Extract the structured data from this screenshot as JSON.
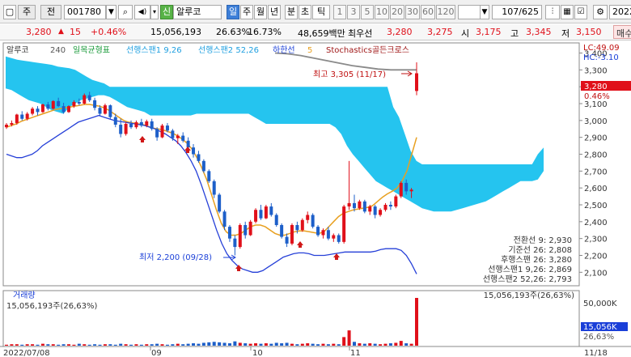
{
  "toolbar": {
    "period_label": "주",
    "prev_label": "전",
    "code": "001780",
    "sin_label": "신",
    "stock_name": "알루코",
    "period_tabs": [
      "일",
      "주",
      "월",
      "년",
      "분",
      "초",
      "틱"
    ],
    "active_period": "일",
    "interval_buttons": [
      "1",
      "3",
      "5",
      "10",
      "20",
      "30",
      "60",
      "120"
    ],
    "page_counter": "107/625",
    "date_field": "2022"
  },
  "quote": {
    "price": "3,280",
    "change": "15",
    "change_pct": "+0.46%",
    "volume": "15,056,193",
    "turnover_pct": "26.63%",
    "ratio": "16.73%",
    "amount": "48,659백만",
    "best_label": "최우선",
    "ask": "3,280",
    "bid": "3,275",
    "open_label": "시",
    "open": "3,175",
    "high_label": "고",
    "high": "3,345",
    "low_label": "저",
    "low": "3,150",
    "order_label": "매수"
  },
  "legend": {
    "stock": "알루코",
    "period": "240",
    "ichimoku": "일목균형표",
    "span1": "선행스팬1 9,26",
    "span2": "선행스팬2 52,26",
    "lower_line": "하한선",
    "num5": "5",
    "stoch": "Stochastics골든크로스"
  },
  "annotations": {
    "max": "최고 3,305 (11/17)",
    "min": "최저 2,200 (09/28)"
  },
  "right_info": {
    "lc": "LC:49.09",
    "hc": "HC:-3.10",
    "price_tag": "3,280",
    "pct_tag": "0.46%",
    "values": [
      {
        "text": "전환선 9: 2,930",
        "color": "#1e9fe0"
      },
      {
        "text": "기준선 26: 2,808",
        "color": "#333333"
      },
      {
        "text": "후행스팬 26: 3,280",
        "color": "#a020a0"
      },
      {
        "text": "선행스팬1 9,26: 2,869",
        "color": "#1e9fe0"
      },
      {
        "text": "선행스팬2 52,26: 2,793",
        "color": "#1a3fd8"
      }
    ]
  },
  "volume_panel": {
    "title": "거래량",
    "value_left": "15,056,193주(26,63%)",
    "value_right": "15,056,193주(26,63%)",
    "axis_label": "50,000K",
    "tag": "15,056K",
    "tag_pct": "26,63%"
  },
  "colors": {
    "up": "#e0101a",
    "down": "#1d5fc9",
    "cloud": "#19c1ee",
    "ma": "#e8a020",
    "lower": "#2640d8",
    "gray_line": "#8a8a8a"
  },
  "chart_data": {
    "type": "candlestick",
    "y_ticks": [
      2100,
      2200,
      2300,
      2400,
      2500,
      2600,
      2700,
      2800,
      2900,
      3000,
      3100,
      3200,
      3300,
      3400
    ],
    "ylim": [
      2020,
      3460
    ],
    "x_labels": [
      "2022/07/08",
      "09",
      "10",
      "11",
      "11/18"
    ],
    "candles": [
      [
        2960,
        2985,
        2950,
        2975
      ],
      [
        2975,
        3000,
        2965,
        2985
      ],
      [
        2985,
        3040,
        2975,
        3035
      ],
      [
        3035,
        3055,
        3000,
        3010
      ],
      [
        3010,
        3050,
        3000,
        3040
      ],
      [
        3040,
        3080,
        3030,
        3070
      ],
      [
        3070,
        3085,
        3030,
        3050
      ],
      [
        3050,
        3100,
        3045,
        3095
      ],
      [
        3095,
        3110,
        3060,
        3070
      ],
      [
        3070,
        3120,
        3065,
        3115
      ],
      [
        3115,
        3135,
        3080,
        3085
      ],
      [
        3085,
        3105,
        3040,
        3050
      ],
      [
        3050,
        3090,
        3045,
        3085
      ],
      [
        3085,
        3120,
        3075,
        3110
      ],
      [
        3110,
        3130,
        3090,
        3100
      ],
      [
        3100,
        3160,
        3095,
        3150
      ],
      [
        3150,
        3170,
        3110,
        3120
      ],
      [
        3120,
        3135,
        3060,
        3075
      ],
      [
        3075,
        3090,
        3030,
        3040
      ],
      [
        3040,
        3100,
        3035,
        3090
      ],
      [
        3090,
        3095,
        3010,
        3020
      ],
      [
        3020,
        3040,
        2960,
        2975
      ],
      [
        2975,
        3010,
        2900,
        2920
      ],
      [
        2920,
        2990,
        2910,
        2980
      ],
      [
        2980,
        3000,
        2950,
        2960
      ],
      [
        2960,
        3000,
        2950,
        2990
      ],
      [
        2990,
        3010,
        2960,
        2970
      ],
      [
        2970,
        3005,
        2960,
        2995
      ],
      [
        2995,
        3010,
        2940,
        2950
      ],
      [
        2950,
        2960,
        2880,
        2900
      ],
      [
        2900,
        2980,
        2895,
        2970
      ],
      [
        2970,
        2985,
        2930,
        2940
      ],
      [
        2940,
        2950,
        2880,
        2895
      ],
      [
        2895,
        2920,
        2860,
        2910
      ],
      [
        2910,
        2930,
        2870,
        2880
      ],
      [
        2880,
        2900,
        2830,
        2840
      ],
      [
        2840,
        2860,
        2780,
        2800
      ],
      [
        2800,
        2820,
        2750,
        2760
      ],
      [
        2760,
        2770,
        2690,
        2700
      ],
      [
        2700,
        2710,
        2630,
        2640
      ],
      [
        2640,
        2650,
        2540,
        2560
      ],
      [
        2560,
        2570,
        2450,
        2460
      ],
      [
        2460,
        2470,
        2350,
        2370
      ],
      [
        2370,
        2380,
        2280,
        2300
      ],
      [
        2300,
        2320,
        2200,
        2250
      ],
      [
        2250,
        2390,
        2240,
        2380
      ],
      [
        2380,
        2400,
        2300,
        2320
      ],
      [
        2320,
        2410,
        2315,
        2400
      ],
      [
        2400,
        2480,
        2390,
        2470
      ],
      [
        2470,
        2500,
        2410,
        2420
      ],
      [
        2420,
        2500,
        2415,
        2490
      ],
      [
        2490,
        2510,
        2430,
        2440
      ],
      [
        2440,
        2450,
        2370,
        2380
      ],
      [
        2380,
        2390,
        2300,
        2310
      ],
      [
        2310,
        2330,
        2250,
        2270
      ],
      [
        2270,
        2390,
        2260,
        2380
      ],
      [
        2380,
        2400,
        2330,
        2350
      ],
      [
        2350,
        2420,
        2340,
        2410
      ],
      [
        2410,
        2460,
        2390,
        2440
      ],
      [
        2440,
        2450,
        2360,
        2370
      ],
      [
        2370,
        2380,
        2310,
        2320
      ],
      [
        2320,
        2360,
        2300,
        2350
      ],
      [
        2350,
        2370,
        2290,
        2300
      ],
      [
        2300,
        2330,
        2280,
        2320
      ],
      [
        2320,
        2330,
        2270,
        2280
      ],
      [
        2280,
        2500,
        2270,
        2490
      ],
      [
        2490,
        2760,
        2470,
        2510
      ],
      [
        2510,
        2560,
        2460,
        2480
      ],
      [
        2480,
        2530,
        2470,
        2520
      ],
      [
        2520,
        2530,
        2450,
        2460
      ],
      [
        2460,
        2500,
        2440,
        2490
      ],
      [
        2490,
        2500,
        2420,
        2440
      ],
      [
        2440,
        2480,
        2430,
        2470
      ],
      [
        2470,
        2510,
        2460,
        2500
      ],
      [
        2500,
        2520,
        2470,
        2490
      ],
      [
        2490,
        2560,
        2480,
        2550
      ],
      [
        2550,
        2640,
        2540,
        2630
      ],
      [
        2630,
        2650,
        2560,
        2580
      ],
      [
        2580,
        2600,
        2540,
        2590
      ],
      [
        3175,
        3345,
        3150,
        3280
      ]
    ],
    "volumes": [
      2,
      3,
      3,
      2,
      3,
      3,
      2,
      4,
      3,
      3,
      2,
      3,
      3,
      2,
      4,
      3,
      2,
      3,
      2,
      3,
      3,
      2,
      4,
      3,
      2,
      3,
      2,
      3,
      3,
      4,
      3,
      2,
      3,
      4,
      3,
      4,
      5,
      4,
      6,
      7,
      8,
      7,
      6,
      5,
      9,
      6,
      5,
      4,
      5,
      4,
      5,
      4,
      6,
      5,
      6,
      4,
      3,
      4,
      5,
      4,
      3,
      4,
      3,
      4,
      3,
      18,
      32,
      8,
      5,
      4,
      5,
      4,
      3,
      4,
      5,
      6,
      10,
      5,
      4,
      100
    ],
    "cloud_upper": [
      3380,
      3370,
      3360,
      3355,
      3350,
      3345,
      3340,
      3335,
      3330,
      3320,
      3315,
      3310,
      3300,
      3280,
      3260,
      3240,
      3230,
      3220,
      3200,
      3200,
      3200,
      3200,
      3200,
      3200,
      3200,
      3200,
      3200,
      3200,
      3200,
      3200,
      3200,
      3200,
      3200,
      3200,
      3200,
      3200,
      3200,
      3200,
      3200,
      3200,
      3200,
      3200,
      3200,
      3200,
      3200,
      3200,
      3200,
      3200,
      3200,
      3200,
      3200,
      3200,
      3200,
      3200,
      3200,
      3200,
      3200,
      3200,
      3200,
      3200,
      3200,
      3200,
      3200,
      3200,
      3200,
      3200,
      3200,
      3080,
      3020,
      2920,
      2820,
      2760,
      2740,
      2740,
      2740,
      2740,
      2740,
      2740,
      2740,
      2740,
      2740,
      2740,
      2740,
      2740,
      2740,
      2740,
      2740,
      2740,
      2740,
      2740,
      2740,
      2740,
      2800,
      2840
    ],
    "cloud_lower": [
      3190,
      3180,
      3160,
      3140,
      3120,
      3110,
      3100,
      3080,
      3060,
      3050,
      3040,
      3080,
      3100,
      3120,
      3130,
      3140,
      3150,
      3150,
      3140,
      3120,
      3100,
      3080,
      3070,
      3060,
      3050,
      3030,
      3030,
      3030,
      3030,
      3030,
      3030,
      3030,
      3030,
      3040,
      3040,
      3040,
      3040,
      3040,
      3040,
      3040,
      3040,
      3040,
      3040,
      3020,
      3000,
      2980,
      2980,
      2980,
      2980,
      2980,
      2980,
      2980,
      2980,
      2980,
      2980,
      2980,
      2980,
      2960,
      2920,
      2850,
      2800,
      2760,
      2720,
      2680,
      2640,
      2620,
      2600,
      2580,
      2560,
      2540,
      2520,
      2500,
      2480,
      2470,
      2460,
      2460,
      2460,
      2460,
      2470,
      2480,
      2490,
      2500,
      2510,
      2520,
      2540,
      2560,
      2580,
      2600,
      2620,
      2640,
      2640,
      2640,
      2650,
      2700
    ],
    "ma": [
      2960,
      2970,
      2980,
      2995,
      3005,
      3015,
      3025,
      3035,
      3045,
      3055,
      3065,
      3070,
      3075,
      3080,
      3085,
      3090,
      3095,
      3095,
      3090,
      3085,
      3075,
      3060,
      3040,
      3020,
      3000,
      2990,
      2985,
      2980,
      2975,
      2965,
      2955,
      2950,
      2945,
      2935,
      2925,
      2910,
      2890,
      2865,
      2830,
      2780,
      2720,
      2650,
      2560,
      2470,
      2390,
      2340,
      2320,
      2320,
      2330,
      2350,
      2370,
      2380,
      2380,
      2370,
      2350,
      2330,
      2320,
      2320,
      2330,
      2340,
      2345,
      2345,
      2340,
      2335,
      2330,
      2340,
      2370,
      2400,
      2430,
      2450,
      2460,
      2470,
      2475,
      2480,
      2485,
      2495,
      2520,
      2545,
      2565,
      2580,
      2600,
      2640,
      2700,
      2800,
      2900
    ],
    "lower": [
      2800,
      2790,
      2780,
      2780,
      2790,
      2800,
      2820,
      2850,
      2870,
      2890,
      2910,
      2930,
      2950,
      2970,
      2990,
      3000,
      3010,
      3020,
      3030,
      3020,
      3010,
      3000,
      2995,
      2990,
      2985,
      2980,
      2975,
      2970,
      2960,
      2950,
      2935,
      2920,
      2900,
      2880,
      2850,
      2810,
      2760,
      2700,
      2620,
      2530,
      2440,
      2350,
      2270,
      2210,
      2170,
      2140,
      2120,
      2110,
      2100,
      2100,
      2110,
      2130,
      2150,
      2170,
      2190,
      2200,
      2210,
      2215,
      2215,
      2210,
      2200,
      2200,
      2200,
      2205,
      2210,
      2215,
      2220,
      2220,
      2220,
      2220,
      2220,
      2220,
      2225,
      2235,
      2240,
      2240,
      2240,
      2230,
      2200,
      2150,
      2090
    ],
    "gray_line": [
      3400,
      3395,
      3385,
      3370,
      3355,
      3340,
      3325,
      3315,
      3305,
      3300,
      3300,
      3300
    ]
  }
}
